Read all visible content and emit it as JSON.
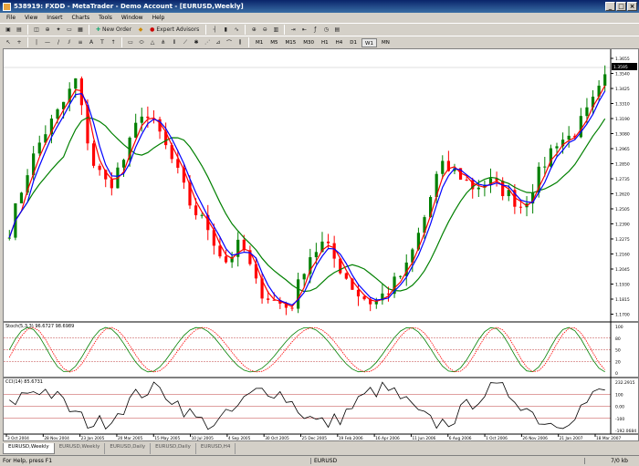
{
  "window": {
    "title": "538919: FXDD - MetaTrader - Demo Account - [EURUSD,Weekly]"
  },
  "menu": [
    "File",
    "View",
    "Insert",
    "Charts",
    "Tools",
    "Window",
    "Help"
  ],
  "toolbar": {
    "new_order": "New Order",
    "expert_advisors": "Expert Advisors"
  },
  "timeframes": [
    "M1",
    "M5",
    "M15",
    "M30",
    "H1",
    "H4",
    "D1",
    "W1",
    "MN"
  ],
  "active_timeframe": "W1",
  "chart": {
    "price_ticks": [
      "1.3655",
      "1.3540",
      "1.3425",
      "1.3310",
      "1.3190",
      "1.3080",
      "1.2965",
      "1.2850",
      "1.2735",
      "1.2620",
      "1.2505",
      "1.2390",
      "1.2275",
      "1.2160",
      "1.2045",
      "1.1930",
      "1.1815",
      "1.1700"
    ],
    "current_price": "1.3595",
    "date_labels": [
      "3 Oct 2004",
      "28 Nov 2004",
      "23 Jan 2005",
      "20 Mar 2005",
      "15 May 2005",
      "10 Jul 2005",
      "4 Sep 2005",
      "30 Oct 2005",
      "25 Dec 2005",
      "19 Feb 2006",
      "16 Apr 2006",
      "11 Jun 2006",
      "6 Aug 2006",
      "1 Oct 2006",
      "26 Nov 2006",
      "21 Jan 2007",
      "18 Mar 2007"
    ],
    "colors": {
      "bull": "#008000",
      "bear": "#ff0000",
      "ma_fast": "#0000ff",
      "ma_mid": "#ff0000",
      "ma_slow": "#008000",
      "grid_line": "#c04040"
    },
    "stoch_label": "Stoch(5,3,3) 96.6727 98.6989",
    "stoch_ticks": [
      "100",
      "80",
      "50",
      "20",
      "0"
    ],
    "cci_label": "CCI(14) 85.6731",
    "cci_ticks": [
      "232.2915",
      "100",
      "0.00",
      "-100",
      "-192.0684"
    ]
  },
  "tabs": [
    "EURUSD,Weekly",
    "EURUSD,Weekly",
    "EURUSD,Daily",
    "EURUSD,Daily",
    "EURUSD,H4"
  ],
  "status": {
    "help": "For Help, press F1",
    "symbol": "EURUSD",
    "connection": "7/0 kb"
  }
}
